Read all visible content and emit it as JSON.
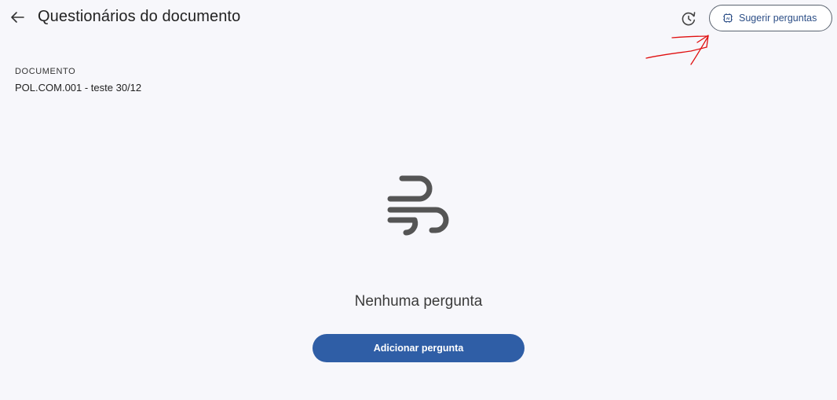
{
  "header": {
    "title": "Questionários do documento",
    "back_icon": "arrow-left-icon",
    "history_icon": "history-icon",
    "suggest_button": {
      "label": "Sugerir perguntas",
      "icon": "ai-chip-icon"
    }
  },
  "document": {
    "caption": "DOCUMENTO",
    "name": "POL.COM.001 - teste 30/12"
  },
  "empty_state": {
    "icon": "wind-icon",
    "message": "Nenhuma pergunta",
    "action_label": "Adicionar pergunta"
  },
  "colors": {
    "background": "#f7f7fb",
    "primary": "#2f5ea6",
    "link": "#2d4f87",
    "annotation": "#e01010",
    "illustration": "#555555"
  }
}
